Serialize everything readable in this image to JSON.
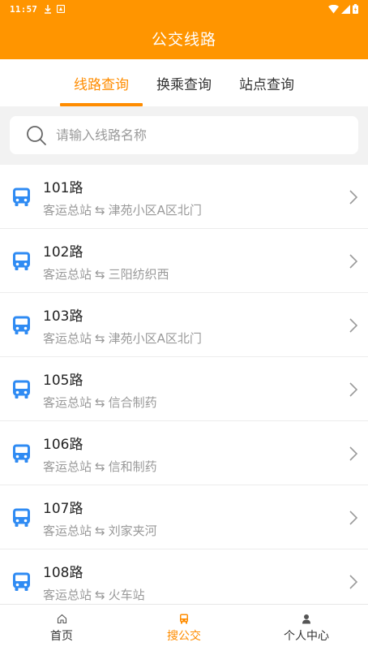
{
  "status_bar": {
    "time": "11:57",
    "left_icons": [
      "download-icon",
      "app-notification-icon"
    ],
    "right_icons": [
      "wifi-icon",
      "signal-icon",
      "battery-icon"
    ]
  },
  "app_bar": {
    "title": "公交线路"
  },
  "tabs": [
    {
      "label": "线路查询",
      "active": true
    },
    {
      "label": "换乘查询",
      "active": false
    },
    {
      "label": "站点查询",
      "active": false
    }
  ],
  "search": {
    "placeholder": "请输入线路名称",
    "value": "",
    "icon": "search-icon"
  },
  "routes": [
    {
      "name": "101路",
      "from": "客运总站",
      "arrow": "⇆",
      "to": "津苑小区A区北门"
    },
    {
      "name": "102路",
      "from": "客运总站",
      "arrow": "⇆",
      "to": "三阳纺织西"
    },
    {
      "name": "103路",
      "from": "客运总站",
      "arrow": "⇆",
      "to": "津苑小区A区北门"
    },
    {
      "name": "105路",
      "from": "客运总站",
      "arrow": "⇆",
      "to": "信合制药"
    },
    {
      "name": "106路",
      "from": "客运总站",
      "arrow": "⇆",
      "to": "信和制药"
    },
    {
      "name": "107路",
      "from": "客运总站",
      "arrow": "⇆",
      "to": "刘家夹河"
    },
    {
      "name": "108路",
      "from": "客运总站",
      "arrow": "⇆",
      "to": "火车站"
    }
  ],
  "bottom_nav": [
    {
      "label": "首页",
      "icon": "home-icon",
      "active": false
    },
    {
      "label": "搜公交",
      "icon": "bus-icon",
      "active": true
    },
    {
      "label": "个人中心",
      "icon": "person-icon",
      "active": false
    }
  ],
  "colors": {
    "primary": "#ff9500",
    "accent": "#ff8c00",
    "bus_icon": "#2f8bf3",
    "text_secondary": "#999999"
  }
}
